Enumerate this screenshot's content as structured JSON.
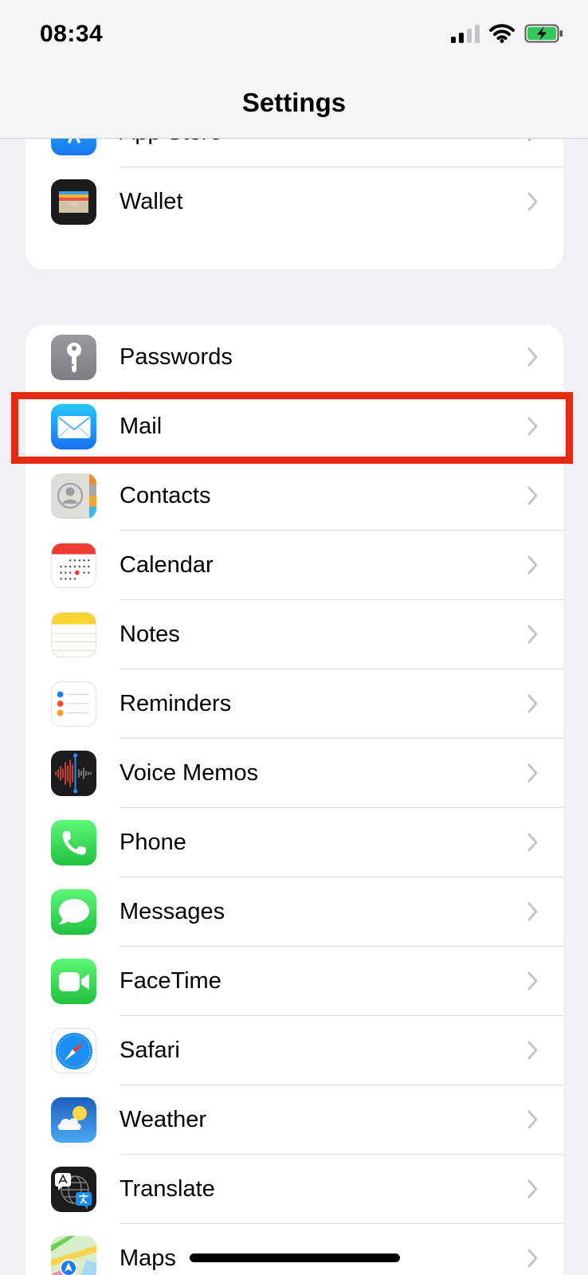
{
  "status_bar": {
    "time": "08:34"
  },
  "nav": {
    "title": "Settings"
  },
  "group1": [
    {
      "label": "App Store",
      "icon": "app-store-icon"
    },
    {
      "label": "Wallet",
      "icon": "wallet-icon"
    }
  ],
  "group2": [
    {
      "label": "Passwords",
      "icon": "passwords-key-icon"
    },
    {
      "label": "Mail",
      "icon": "mail-envelope-icon"
    },
    {
      "label": "Contacts",
      "icon": "contacts-icon"
    },
    {
      "label": "Calendar",
      "icon": "calendar-icon"
    },
    {
      "label": "Notes",
      "icon": "notes-icon"
    },
    {
      "label": "Reminders",
      "icon": "reminders-icon"
    },
    {
      "label": "Voice Memos",
      "icon": "voice-memos-icon"
    },
    {
      "label": "Phone",
      "icon": "phone-icon"
    },
    {
      "label": "Messages",
      "icon": "messages-icon"
    },
    {
      "label": "FaceTime",
      "icon": "facetime-icon"
    },
    {
      "label": "Safari",
      "icon": "safari-compass-icon"
    },
    {
      "label": "Weather",
      "icon": "weather-icon"
    },
    {
      "label": "Translate",
      "icon": "translate-icon"
    },
    {
      "label": "Maps",
      "icon": "maps-icon"
    }
  ],
  "colors": {
    "highlight": "#e32a12",
    "background": "#f0eff5",
    "battery_charging": "#34c759"
  }
}
